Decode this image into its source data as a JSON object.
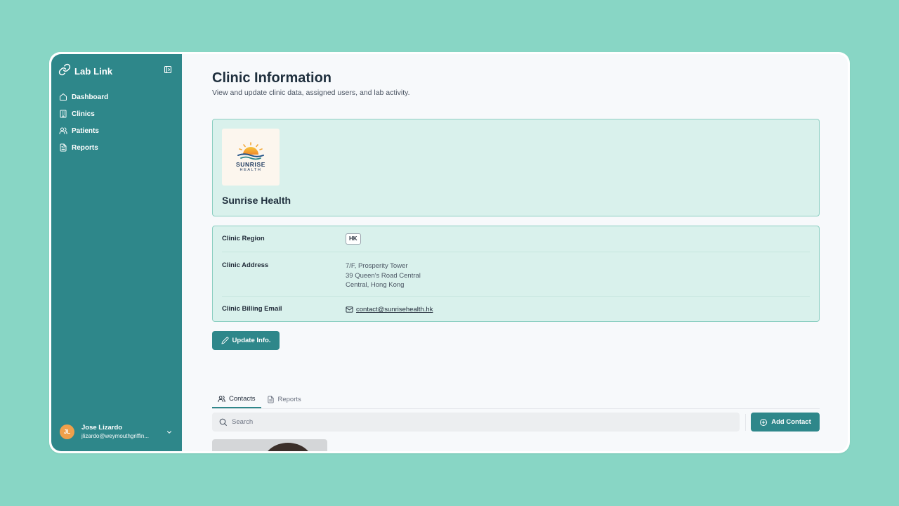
{
  "app": {
    "name": "Lab Link"
  },
  "sidebar": {
    "items": [
      {
        "label": "Dashboard",
        "icon": "home-icon"
      },
      {
        "label": "Clinics",
        "icon": "building-icon"
      },
      {
        "label": "Patients",
        "icon": "users-icon"
      },
      {
        "label": "Reports",
        "icon": "file-text-icon"
      }
    ],
    "user": {
      "initials": "JL",
      "name": "Jose Lizardo",
      "email": "jlizardo@weymouthgriffin..."
    }
  },
  "header": {
    "title": "Clinic Information",
    "subtitle": "View and update clinic data, assigned users, and lab activity."
  },
  "clinic": {
    "logo_text": "SUNRISE",
    "logo_subtext": "HEALTH",
    "name": "Sunrise Health",
    "fields": {
      "region_label": "Clinic Region",
      "region_value": "HK",
      "address_label": "Clinic Address",
      "address_lines": [
        "7/F, Prosperity Tower",
        "39 Queen's Road Central",
        "Central, Hong Kong"
      ],
      "billing_label": "Clinic Billing Email",
      "billing_email": "contact@sunrisehealth.hk"
    }
  },
  "actions": {
    "update_label": "Update Info.",
    "add_contact_label": "Add Contact"
  },
  "tabs": [
    {
      "label": "Contacts",
      "active": true,
      "icon": "users-icon"
    },
    {
      "label": "Reports",
      "active": false,
      "icon": "file-text-icon"
    }
  ],
  "search": {
    "placeholder": "Search",
    "value": ""
  },
  "colors": {
    "background": "#88d6c5",
    "sidebar": "#2e878a",
    "accent": "#2e878a",
    "card_bg": "#d9f1ec",
    "card_border": "#8ccfc2",
    "avatar": "#f0a04b"
  }
}
